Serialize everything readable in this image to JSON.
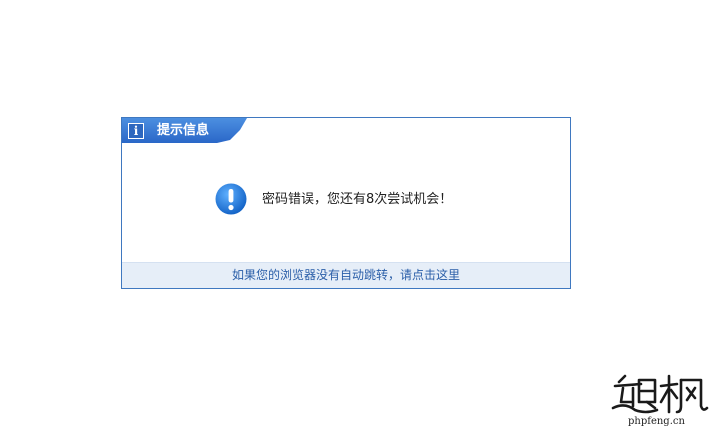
{
  "dialog": {
    "title": "提示信息",
    "message": "密码错误，您还有8次尝试机会！",
    "redirect_link": "如果您的浏览器没有自动跳转，请点击这里"
  },
  "icons": {
    "header": "info-icon",
    "body": "exclamation-icon"
  },
  "colors": {
    "border": "#3f78c0",
    "header_tab": "#2a67c8",
    "footer_bg": "#e6eef8",
    "link": "#2a5ea8",
    "alert_icon": "#1f78d6"
  },
  "watermark": {
    "logo_text": "跑枫",
    "domain": "phpfeng.cn"
  }
}
